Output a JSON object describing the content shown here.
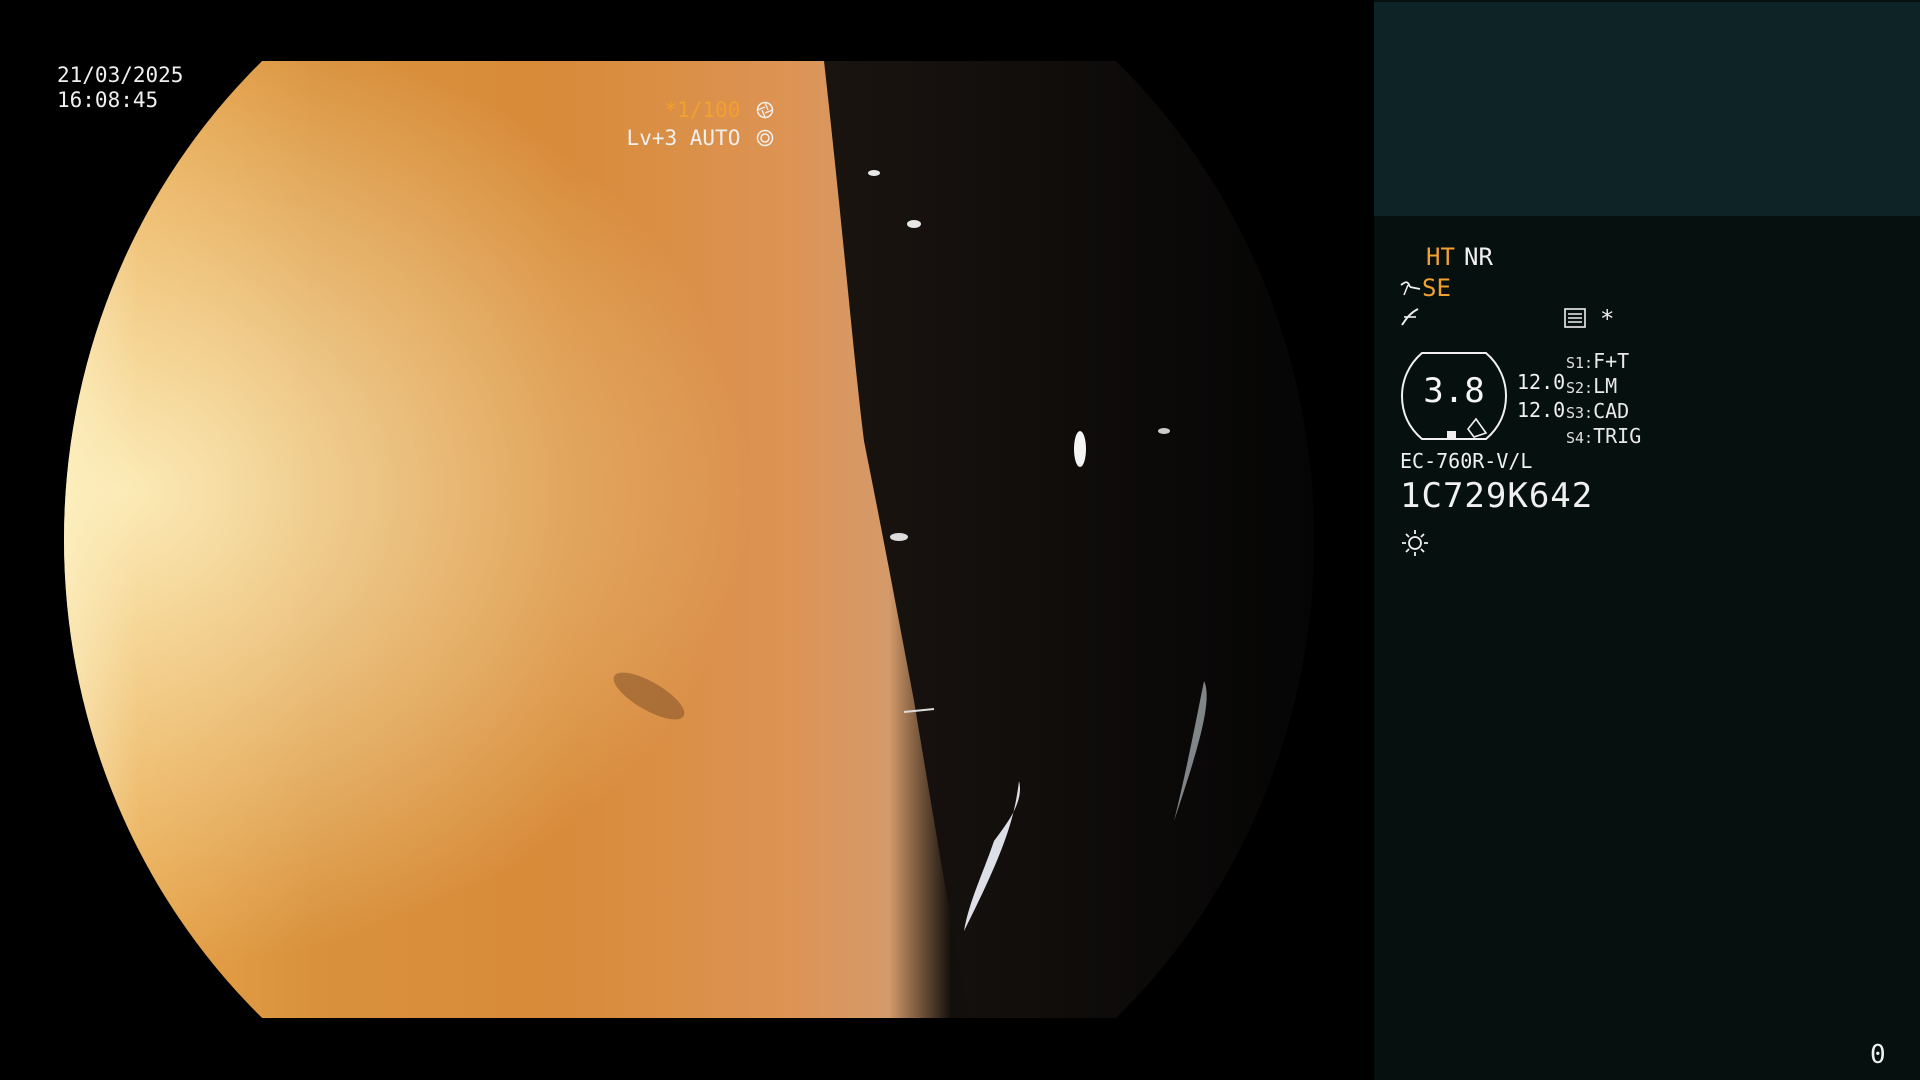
{
  "video": {
    "date": "21/03/2025",
    "time": "16:08:45",
    "shutter": "*1/100",
    "shutter_icon": "aperture-icon",
    "level": "Lv+3 AUTO",
    "level_icon": "iris-icon"
  },
  "panel": {
    "ht": "HT",
    "nr": "NR",
    "se": "SE",
    "asterisk": "*",
    "zoom": "3.8",
    "value_1": "12.0",
    "value_2": "12.0",
    "switches": [
      {
        "key": "S1:",
        "value": "F+T"
      },
      {
        "key": "S2:",
        "value": "LM"
      },
      {
        "key": "S3:",
        "value": "CAD"
      },
      {
        "key": "S4:",
        "value": "TRIG"
      }
    ],
    "scope_model": "EC-760R-V/L",
    "scope_serial": "1C729K642",
    "counter": "0"
  },
  "colors": {
    "accent_orange": "#f2a030",
    "panel_bg": "#05100f",
    "thumbnail_bg": "#0e2326"
  }
}
